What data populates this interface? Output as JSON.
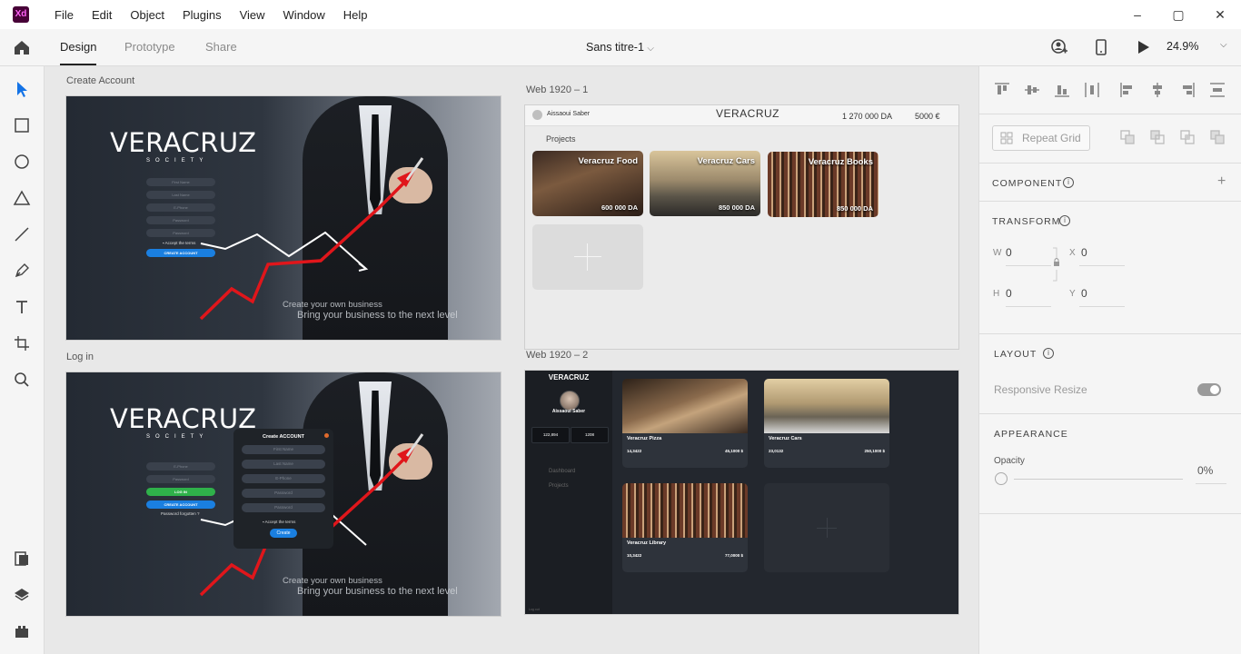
{
  "app": {
    "logo": "Xd",
    "menu": [
      "File",
      "Edit",
      "Object",
      "Plugins",
      "View",
      "Window",
      "Help"
    ],
    "window_controls": {
      "minimize": "–",
      "maximize": "▢",
      "close": "✕"
    }
  },
  "toolbar": {
    "tabs": [
      "Design",
      "Prototype",
      "Share"
    ],
    "active_tab": "Design",
    "document_title": "Sans titre-1",
    "zoom": "24.9%"
  },
  "left_tools": [
    "select-icon",
    "rectangle-icon",
    "ellipse-icon",
    "polygon-icon",
    "line-icon",
    "pen-icon",
    "text-icon",
    "artboard-icon",
    "zoom-icon",
    "assets-icon",
    "layers-icon",
    "plugins-icon"
  ],
  "artboards": {
    "create_account": {
      "label": "Create Account",
      "brand": "VERACRUZ",
      "brand_sub": "SOCIETY",
      "fields": [
        "First Name",
        "Last Name",
        "E-Phone",
        "Password",
        "Password"
      ],
      "accept": "Accept the terms",
      "button": "CREATE ACCOUNT",
      "tagline1": "Create your own business",
      "tagline2": "Bring your business to the next level"
    },
    "log_in": {
      "label": "Log in",
      "brand": "VERACRUZ",
      "brand_sub": "SOCIETY",
      "fields": [
        "E-Phone",
        "Password"
      ],
      "login_button": "LOG IN",
      "create_button": "CREATE ACCOUNT",
      "forgot": "Password forgotten ?",
      "modal": {
        "title": "Create ACCOUNT",
        "fields": [
          "First Name",
          "Last Name",
          "E-Phone",
          "Password",
          "Password"
        ],
        "accept": "Accept the terms",
        "button": "Create"
      },
      "tagline1": "Create your own business",
      "tagline2": "Bring your business to the next level"
    },
    "web1": {
      "label": "Web 1920 – 1",
      "user": "Aissaoui Saber",
      "logo": "VERACRUZ",
      "balance1": "1 270 000 DA",
      "balance2": "5000 €",
      "projects_title": "Projects",
      "projects": [
        {
          "name": "Veracruz Food",
          "price": "600 000 DA"
        },
        {
          "name": "Veracruz Cars",
          "price": "850 000 DA"
        },
        {
          "name": "Veracruz Books",
          "price": "850 000 DA"
        }
      ]
    },
    "web2": {
      "label": "Web 1920 – 2",
      "logo": "VERACRUZ",
      "user": "Aissaoui Saber",
      "balance1": "122,894",
      "balance2": "1208",
      "nav": [
        "Dashboard",
        "Projects"
      ],
      "logout": "Log out",
      "cards": [
        {
          "name": "Veracruz Pizza",
          "stats": [
            "14,3422",
            "",
            "",
            "45,1000 $"
          ]
        },
        {
          "name": "Veracruz Cars",
          "stats": [
            "23,0132",
            "",
            "",
            "250,1000 $"
          ]
        },
        {
          "name": "Veracruz Library",
          "stats": [
            "10,3422",
            "",
            "",
            "77,0000 $"
          ]
        }
      ]
    }
  },
  "right_panel": {
    "repeat_grid": "Repeat Grid",
    "component": "COMPONENT",
    "transform": "TRANSFORM",
    "w_label": "W",
    "w_value": "0",
    "x_label": "X",
    "x_value": "0",
    "h_label": "H",
    "h_value": "0",
    "y_label": "Y",
    "y_value": "0",
    "layout": "LAYOUT",
    "responsive_resize": "Responsive Resize",
    "responsive_resize_on": true,
    "appearance": "APPEARANCE",
    "opacity_label": "Opacity",
    "opacity_value": "0%"
  },
  "colors": {
    "accent_blue": "#1473e6",
    "xd_brand": "#470137",
    "xd_pink": "#ff61f6",
    "login_green": "#2fb14a",
    "button_blue": "#1a7fe0",
    "arrow_red": "#e0161b"
  }
}
